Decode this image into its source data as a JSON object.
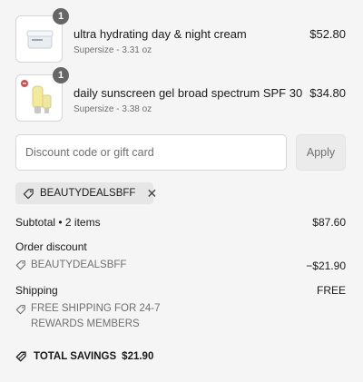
{
  "line_items": [
    {
      "name": "ultra hydrating day & night cream",
      "variant": "Supersize - 3.31 oz",
      "price": "$52.80",
      "quantity": "1",
      "image_icon": "cream-jar-image"
    },
    {
      "name": "daily sunscreen gel broad spectrum SPF 30",
      "variant": "Supersize - 3.38 oz",
      "price": "$34.80",
      "quantity": "1",
      "image_icon": "sunscreen-tube-image"
    }
  ],
  "discount": {
    "placeholder": "Discount code or gift card",
    "apply_label": "Apply",
    "applied_code": "BEAUTYDEALSBFF"
  },
  "summary": {
    "subtotal_label": "Subtotal • 2 items",
    "subtotal_value": "$87.60",
    "order_discount_label": "Order discount",
    "order_discount_code": "BEAUTYDEALSBFF",
    "order_discount_value": "−$21.90",
    "shipping_label": "Shipping",
    "shipping_value": "FREE",
    "shipping_note_line1": "FREE SHIPPING FOR 24-7",
    "shipping_note_line2": "REWARDS MEMBERS",
    "total_savings_label": "TOTAL SAVINGS",
    "total_savings_value": "$21.90"
  },
  "colors": {
    "background": "#f5f5f5",
    "badge": "#666666",
    "muted_text": "#707070"
  }
}
